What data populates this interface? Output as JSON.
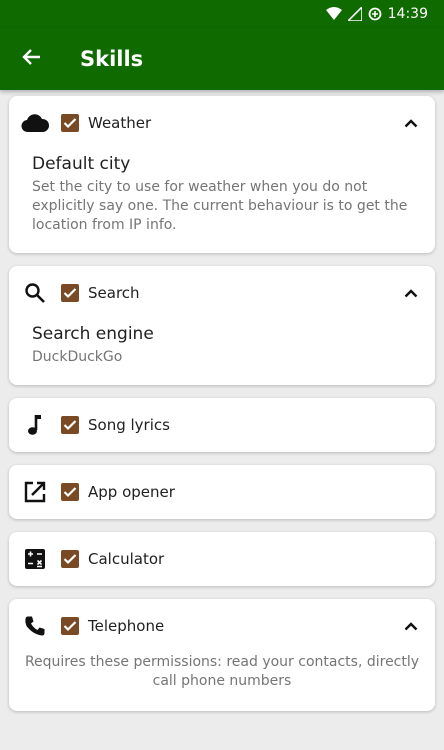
{
  "status_bar": {
    "time": "14:39"
  },
  "app_bar": {
    "title": "Skills"
  },
  "skills": [
    {
      "name": "Weather",
      "icon": "cloud-icon",
      "checked": true,
      "expanded": true,
      "preference": {
        "title": "Default city",
        "description": "Set the city to use for weather when you do not explicitly say one. The current behaviour is to get the location from IP info."
      }
    },
    {
      "name": "Search",
      "icon": "search-icon",
      "checked": true,
      "expanded": true,
      "preference": {
        "title": "Search engine",
        "description": "DuckDuckGo"
      }
    },
    {
      "name": "Song lyrics",
      "icon": "music-note-icon",
      "checked": true,
      "expanded": false
    },
    {
      "name": "App opener",
      "icon": "open-in-new-icon",
      "checked": true,
      "expanded": false
    },
    {
      "name": "Calculator",
      "icon": "calculator-icon",
      "checked": true,
      "expanded": false
    },
    {
      "name": "Telephone",
      "icon": "phone-icon",
      "checked": true,
      "expanded": true,
      "permissions_text": "Requires these permissions: read your contacts, directly call phone numbers"
    }
  ],
  "colors": {
    "primary": "#0f6a00",
    "checkbox": "#7a4a25",
    "background": "#ececec"
  }
}
